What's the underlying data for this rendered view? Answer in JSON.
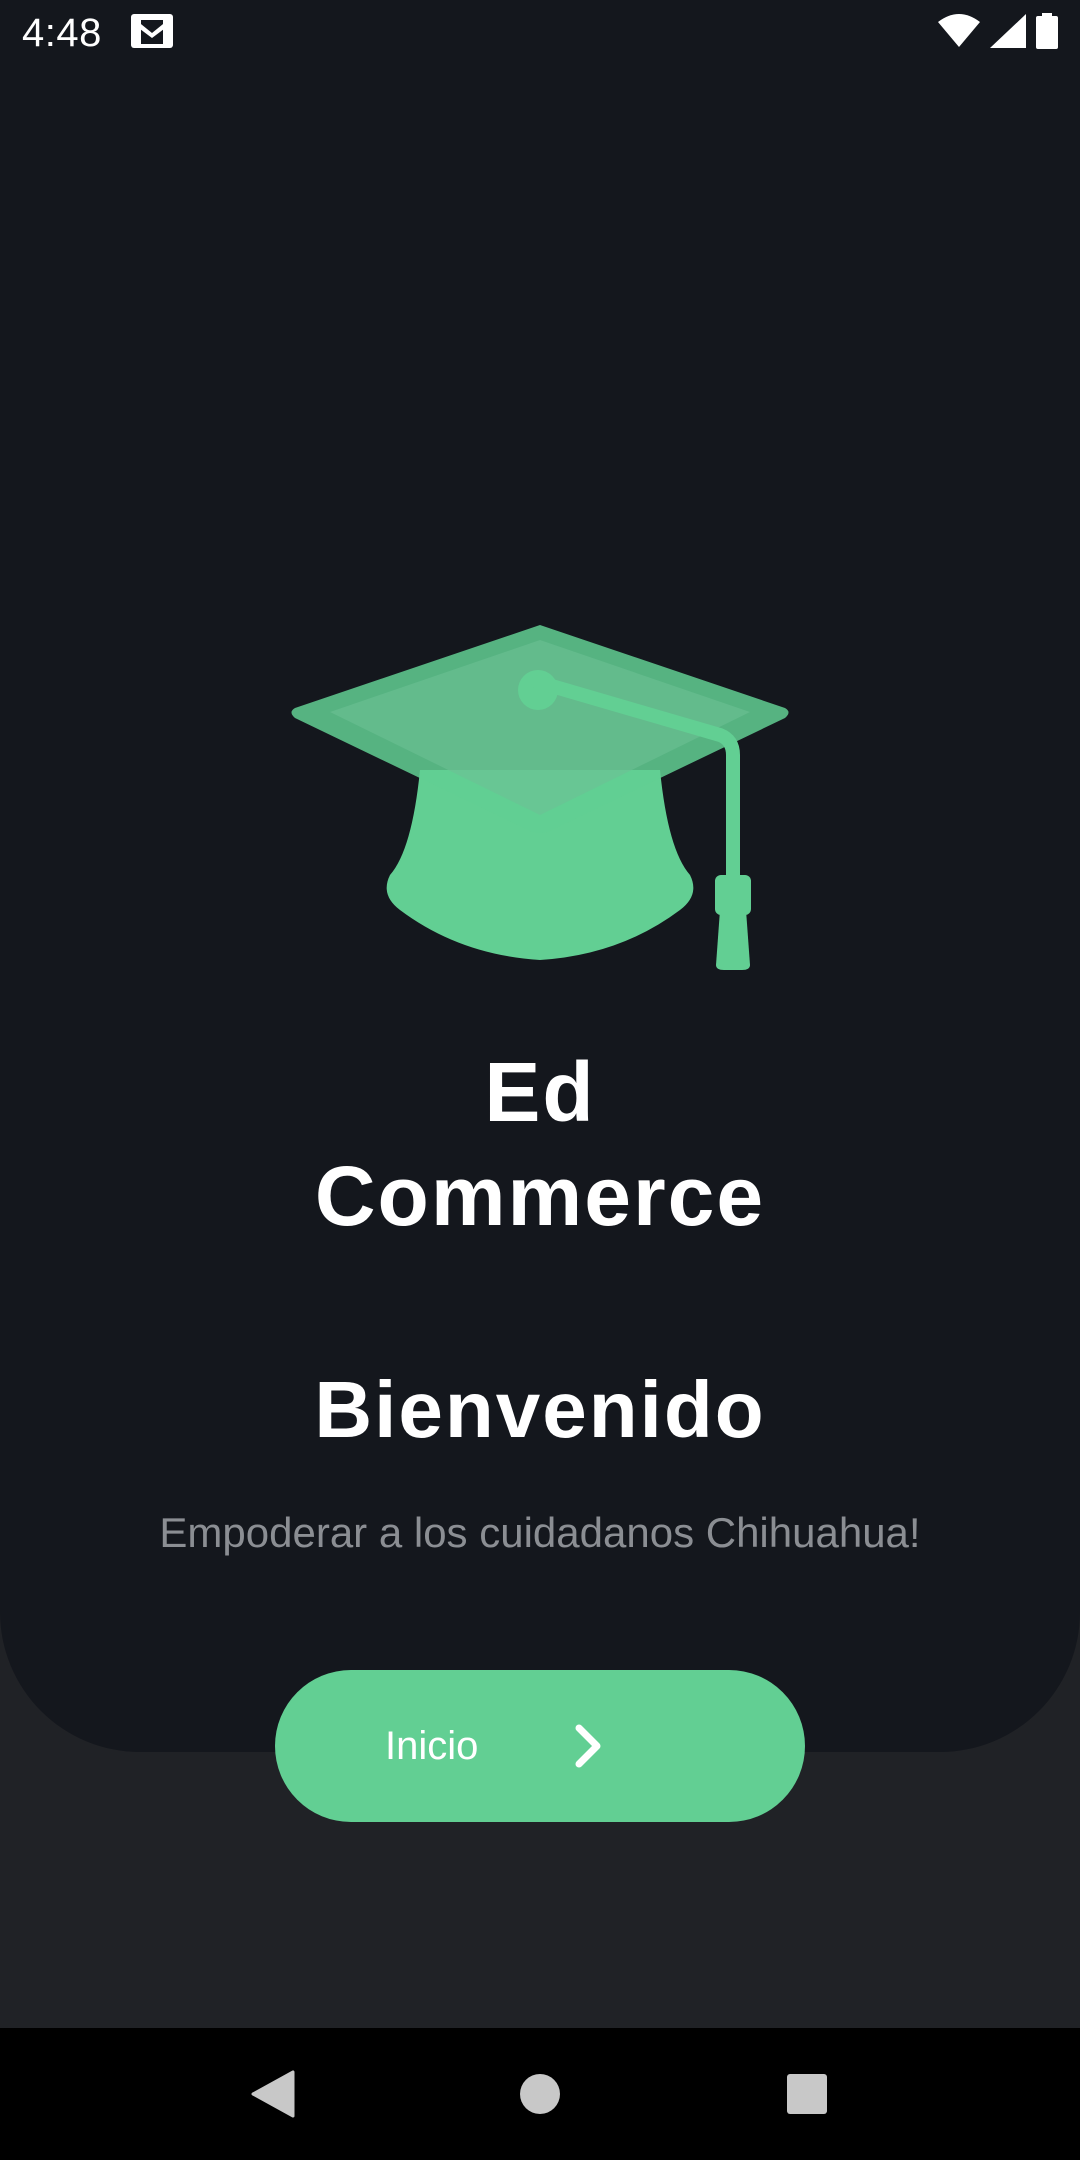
{
  "status_bar": {
    "time": "4:48",
    "notification_icon": "gmail-icon",
    "icons": [
      "wifi-icon",
      "signal-icon",
      "battery-icon"
    ]
  },
  "app": {
    "title": "Ed Commerce",
    "logo_icon": "graduation-cap-icon",
    "welcome": "Bienvenido",
    "tagline": "Empoderar a los cuidadanos Chihuahua!"
  },
  "start_button": {
    "label": "Inicio",
    "icon": "chevron-right-icon"
  },
  "nav_bar": {
    "icons": [
      "back-icon",
      "home-icon",
      "recents-icon"
    ]
  },
  "colors": {
    "accent": "#62cf93",
    "panel": "#14171d",
    "background": "#202226",
    "tagline": "#8b8e93"
  }
}
